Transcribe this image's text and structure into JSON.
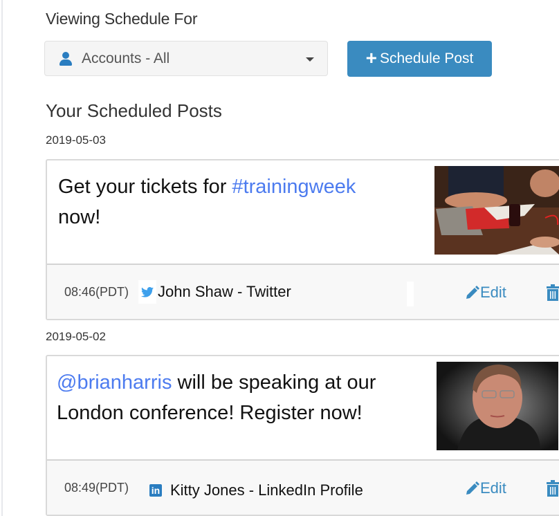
{
  "header": {
    "section_label": "Viewing Schedule For",
    "account_select": {
      "value": "Accounts - All",
      "icon": "user-icon"
    },
    "schedule_button": {
      "icon": "plus-icon",
      "label": "Schedule Post"
    }
  },
  "posts_title": "Your Scheduled Posts",
  "colors": {
    "accent": "#3a8bc0",
    "link": "#4c7bef",
    "twitter": "#1da1f2",
    "linkedin": "#2a7dc0"
  },
  "posts": [
    {
      "date": "2019-05-03",
      "text_before": "Get your tickets for ",
      "link": "#trainingweek",
      "text_after": " now!",
      "image": "people-at-table-with-laptop-photo",
      "time": "08:46(PDT)",
      "network_icon": "twitter-icon",
      "account": "John Shaw - Twitter",
      "edit_label": "Edit"
    },
    {
      "date": "2019-05-02",
      "text_before": "",
      "link": "@brianharris",
      "text_after": " will be speaking at our London conference! Register now!",
      "image": "man-with-glasses-portrait-photo",
      "time": "08:49(PDT)",
      "network_icon": "linkedin-icon",
      "network_icon_text": "in",
      "account": "Kitty Jones - LinkedIn Profile",
      "edit_label": "Edit"
    }
  ]
}
